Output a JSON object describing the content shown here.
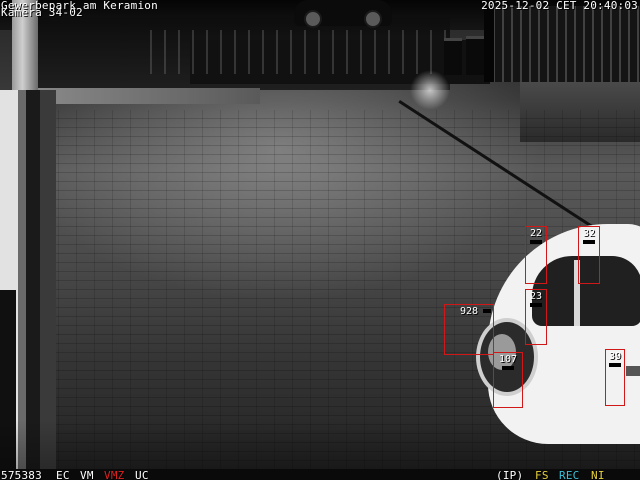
{
  "overlay": {
    "site_name": "Gewerbepark am Keramion",
    "camera_name": "Kamera 34-02",
    "timestamp": "2025-12-02 CET 20:40:03"
  },
  "status_bar": {
    "counter": "575383",
    "flag_ec": "EC",
    "flag_vm": "VM",
    "flag_vmz": "VMZ",
    "flag_uc": "UC",
    "flag_ip": "(IP)",
    "flag_fs": "FS",
    "flag_rec": "REC",
    "flag_ni": "NI"
  },
  "detections": [
    {
      "id": "22"
    },
    {
      "id": "32"
    },
    {
      "id": "23"
    },
    {
      "id": "928"
    },
    {
      "id": "107"
    },
    {
      "id": "39"
    }
  ],
  "colors": {
    "box": "#d01818",
    "vmz": "#e02020",
    "fs": "#e6d23a",
    "rec": "#39c3d8",
    "ni": "#e6d23a"
  }
}
